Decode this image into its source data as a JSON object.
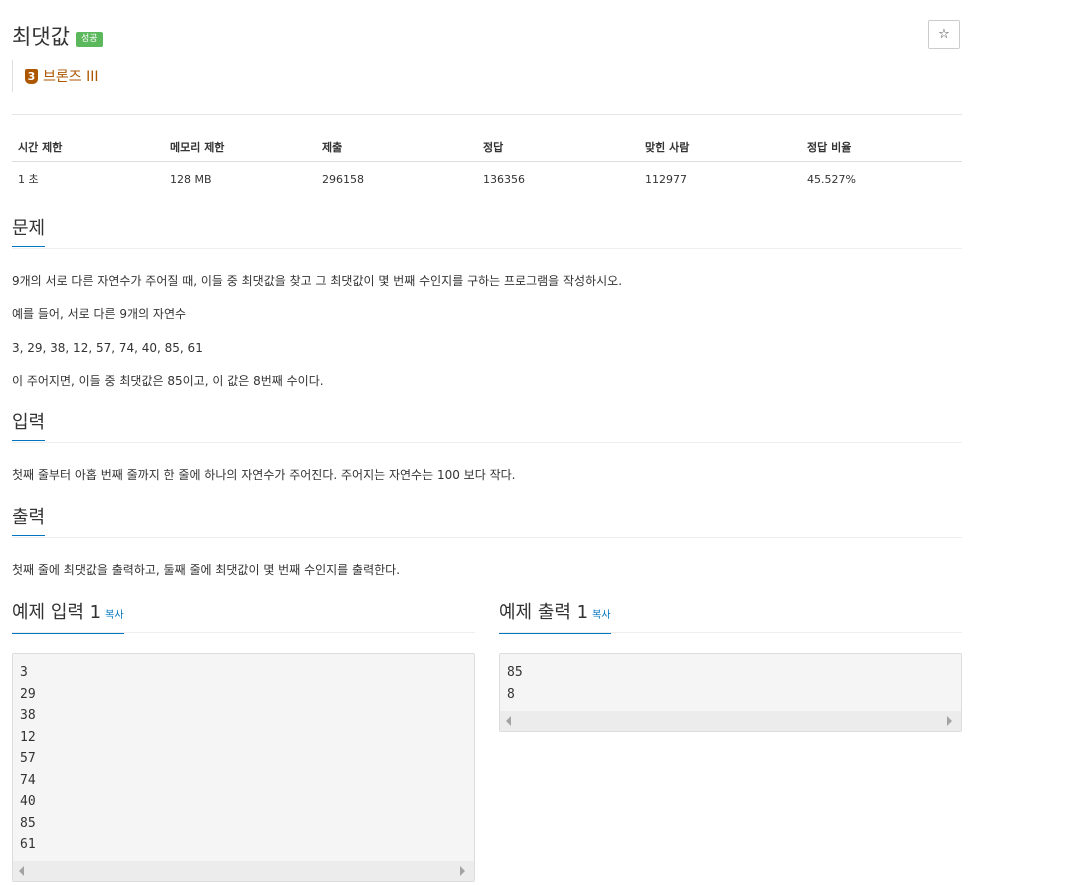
{
  "problem": {
    "title": "최댓값",
    "result_badge": "성공",
    "favorite_icon": "☆",
    "tier": {
      "level": "3",
      "label": "브론즈 III",
      "color": "#ad5600"
    }
  },
  "info_table": {
    "headers": [
      "시간 제한",
      "메모리 제한",
      "제출",
      "정답",
      "맞힌 사람",
      "정답 비율"
    ],
    "values": [
      "1 초",
      "128 MB",
      "296158",
      "136356",
      "112977",
      "45.527%"
    ]
  },
  "description": {
    "heading": "문제",
    "paragraphs": [
      "9개의 서로 다른 자연수가 주어질 때, 이들 중 최댓값을 찾고 그 최댓값이 몇 번째 수인지를 구하는 프로그램을 작성하시오.",
      "예를 들어, 서로 다른 9개의 자연수",
      "3, 29, 38, 12, 57, 74, 40, 85, 61",
      "이 주어지면, 이들 중 최댓값은 85이고, 이 값은 8번째 수이다."
    ]
  },
  "input_section": {
    "heading": "입력",
    "text": "첫째 줄부터 아홉 번째 줄까지 한 줄에 하나의 자연수가 주어진다. 주어지는 자연수는 100 보다 작다."
  },
  "output_section": {
    "heading": "출력",
    "text": "첫째 줄에 최댓값을 출력하고, 둘째 줄에 최댓값이 몇 번째 수인지를 출력한다."
  },
  "sample_input": {
    "heading": "예제 입력 1",
    "copy_label": "복사",
    "lines": [
      "3",
      "29",
      "38",
      "12",
      "57",
      "74",
      "40",
      "85",
      "61"
    ]
  },
  "sample_output": {
    "heading": "예제 출력 1",
    "copy_label": "복사",
    "lines": [
      "85",
      "8"
    ]
  },
  "colors": {
    "accent": "#0076c0",
    "success": "#5cb85c",
    "bronze": "#ad5600"
  }
}
